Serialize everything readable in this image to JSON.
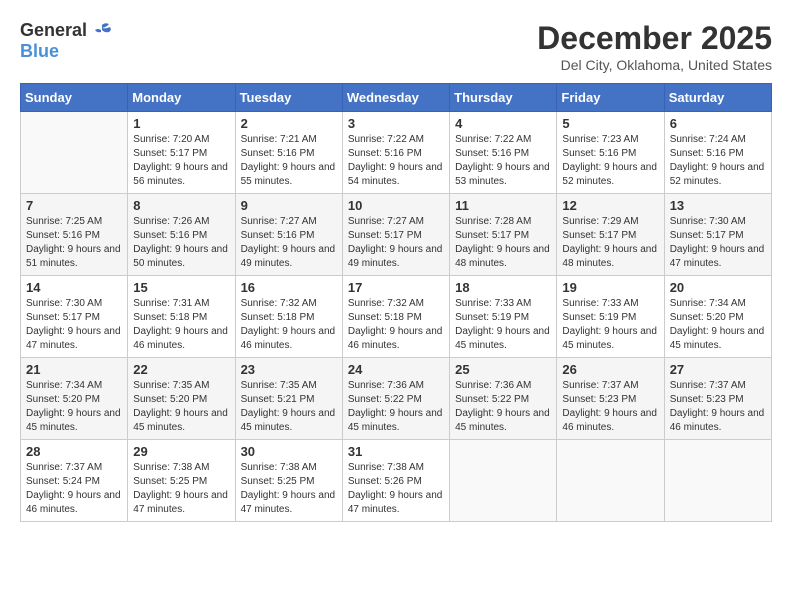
{
  "header": {
    "logo_general": "General",
    "logo_blue": "Blue",
    "month_title": "December 2025",
    "location": "Del City, Oklahoma, United States"
  },
  "days_of_week": [
    "Sunday",
    "Monday",
    "Tuesday",
    "Wednesday",
    "Thursday",
    "Friday",
    "Saturday"
  ],
  "weeks": [
    [
      {
        "day": "",
        "sunrise": "",
        "sunset": "",
        "daylight": ""
      },
      {
        "day": "1",
        "sunrise": "Sunrise: 7:20 AM",
        "sunset": "Sunset: 5:17 PM",
        "daylight": "Daylight: 9 hours and 56 minutes."
      },
      {
        "day": "2",
        "sunrise": "Sunrise: 7:21 AM",
        "sunset": "Sunset: 5:16 PM",
        "daylight": "Daylight: 9 hours and 55 minutes."
      },
      {
        "day": "3",
        "sunrise": "Sunrise: 7:22 AM",
        "sunset": "Sunset: 5:16 PM",
        "daylight": "Daylight: 9 hours and 54 minutes."
      },
      {
        "day": "4",
        "sunrise": "Sunrise: 7:22 AM",
        "sunset": "Sunset: 5:16 PM",
        "daylight": "Daylight: 9 hours and 53 minutes."
      },
      {
        "day": "5",
        "sunrise": "Sunrise: 7:23 AM",
        "sunset": "Sunset: 5:16 PM",
        "daylight": "Daylight: 9 hours and 52 minutes."
      },
      {
        "day": "6",
        "sunrise": "Sunrise: 7:24 AM",
        "sunset": "Sunset: 5:16 PM",
        "daylight": "Daylight: 9 hours and 52 minutes."
      }
    ],
    [
      {
        "day": "7",
        "sunrise": "Sunrise: 7:25 AM",
        "sunset": "Sunset: 5:16 PM",
        "daylight": "Daylight: 9 hours and 51 minutes."
      },
      {
        "day": "8",
        "sunrise": "Sunrise: 7:26 AM",
        "sunset": "Sunset: 5:16 PM",
        "daylight": "Daylight: 9 hours and 50 minutes."
      },
      {
        "day": "9",
        "sunrise": "Sunrise: 7:27 AM",
        "sunset": "Sunset: 5:16 PM",
        "daylight": "Daylight: 9 hours and 49 minutes."
      },
      {
        "day": "10",
        "sunrise": "Sunrise: 7:27 AM",
        "sunset": "Sunset: 5:17 PM",
        "daylight": "Daylight: 9 hours and 49 minutes."
      },
      {
        "day": "11",
        "sunrise": "Sunrise: 7:28 AM",
        "sunset": "Sunset: 5:17 PM",
        "daylight": "Daylight: 9 hours and 48 minutes."
      },
      {
        "day": "12",
        "sunrise": "Sunrise: 7:29 AM",
        "sunset": "Sunset: 5:17 PM",
        "daylight": "Daylight: 9 hours and 48 minutes."
      },
      {
        "day": "13",
        "sunrise": "Sunrise: 7:30 AM",
        "sunset": "Sunset: 5:17 PM",
        "daylight": "Daylight: 9 hours and 47 minutes."
      }
    ],
    [
      {
        "day": "14",
        "sunrise": "Sunrise: 7:30 AM",
        "sunset": "Sunset: 5:17 PM",
        "daylight": "Daylight: 9 hours and 47 minutes."
      },
      {
        "day": "15",
        "sunrise": "Sunrise: 7:31 AM",
        "sunset": "Sunset: 5:18 PM",
        "daylight": "Daylight: 9 hours and 46 minutes."
      },
      {
        "day": "16",
        "sunrise": "Sunrise: 7:32 AM",
        "sunset": "Sunset: 5:18 PM",
        "daylight": "Daylight: 9 hours and 46 minutes."
      },
      {
        "day": "17",
        "sunrise": "Sunrise: 7:32 AM",
        "sunset": "Sunset: 5:18 PM",
        "daylight": "Daylight: 9 hours and 46 minutes."
      },
      {
        "day": "18",
        "sunrise": "Sunrise: 7:33 AM",
        "sunset": "Sunset: 5:19 PM",
        "daylight": "Daylight: 9 hours and 45 minutes."
      },
      {
        "day": "19",
        "sunrise": "Sunrise: 7:33 AM",
        "sunset": "Sunset: 5:19 PM",
        "daylight": "Daylight: 9 hours and 45 minutes."
      },
      {
        "day": "20",
        "sunrise": "Sunrise: 7:34 AM",
        "sunset": "Sunset: 5:20 PM",
        "daylight": "Daylight: 9 hours and 45 minutes."
      }
    ],
    [
      {
        "day": "21",
        "sunrise": "Sunrise: 7:34 AM",
        "sunset": "Sunset: 5:20 PM",
        "daylight": "Daylight: 9 hours and 45 minutes."
      },
      {
        "day": "22",
        "sunrise": "Sunrise: 7:35 AM",
        "sunset": "Sunset: 5:20 PM",
        "daylight": "Daylight: 9 hours and 45 minutes."
      },
      {
        "day": "23",
        "sunrise": "Sunrise: 7:35 AM",
        "sunset": "Sunset: 5:21 PM",
        "daylight": "Daylight: 9 hours and 45 minutes."
      },
      {
        "day": "24",
        "sunrise": "Sunrise: 7:36 AM",
        "sunset": "Sunset: 5:22 PM",
        "daylight": "Daylight: 9 hours and 45 minutes."
      },
      {
        "day": "25",
        "sunrise": "Sunrise: 7:36 AM",
        "sunset": "Sunset: 5:22 PM",
        "daylight": "Daylight: 9 hours and 45 minutes."
      },
      {
        "day": "26",
        "sunrise": "Sunrise: 7:37 AM",
        "sunset": "Sunset: 5:23 PM",
        "daylight": "Daylight: 9 hours and 46 minutes."
      },
      {
        "day": "27",
        "sunrise": "Sunrise: 7:37 AM",
        "sunset": "Sunset: 5:23 PM",
        "daylight": "Daylight: 9 hours and 46 minutes."
      }
    ],
    [
      {
        "day": "28",
        "sunrise": "Sunrise: 7:37 AM",
        "sunset": "Sunset: 5:24 PM",
        "daylight": "Daylight: 9 hours and 46 minutes."
      },
      {
        "day": "29",
        "sunrise": "Sunrise: 7:38 AM",
        "sunset": "Sunset: 5:25 PM",
        "daylight": "Daylight: 9 hours and 47 minutes."
      },
      {
        "day": "30",
        "sunrise": "Sunrise: 7:38 AM",
        "sunset": "Sunset: 5:25 PM",
        "daylight": "Daylight: 9 hours and 47 minutes."
      },
      {
        "day": "31",
        "sunrise": "Sunrise: 7:38 AM",
        "sunset": "Sunset: 5:26 PM",
        "daylight": "Daylight: 9 hours and 47 minutes."
      },
      {
        "day": "",
        "sunrise": "",
        "sunset": "",
        "daylight": ""
      },
      {
        "day": "",
        "sunrise": "",
        "sunset": "",
        "daylight": ""
      },
      {
        "day": "",
        "sunrise": "",
        "sunset": "",
        "daylight": ""
      }
    ]
  ]
}
